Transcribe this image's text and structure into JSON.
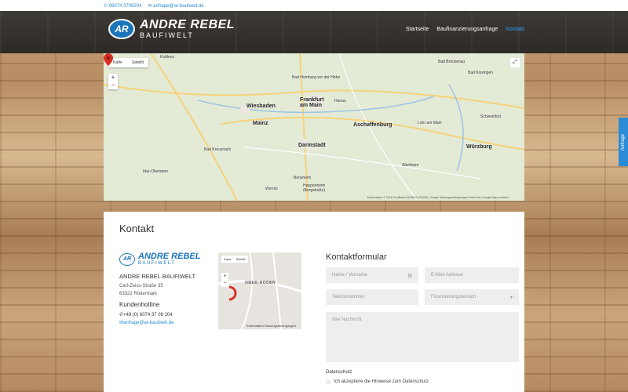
{
  "topbar": {
    "phone": "06074 3708204",
    "email": "anfrage@ar-baufwelt.de"
  },
  "brand": {
    "name": "ANDRE REBEL",
    "sub": "BAUFIWELT",
    "badge": "AR"
  },
  "nav": [
    {
      "label": "Startseite",
      "active": false
    },
    {
      "label": "Baufinanzierungsanfrage",
      "active": false
    },
    {
      "label": "Kontakt",
      "active": true
    }
  ],
  "map": {
    "tabs": [
      "Karte",
      "Satellit"
    ],
    "cities": {
      "frankfurt": "Frankfurt am Main",
      "wiesbaden": "Wiesbaden",
      "mainz": "Mainz",
      "darmstadt": "Darmstadt",
      "hanau": "Hanau",
      "aschaffenburg": "Aschaffenburg",
      "wuerzburg": "Würzburg",
      "schweinfurt": "Schweinfurt",
      "badkissingen": "Bad Kissingen",
      "koblenz": "Koblenz",
      "badkreuznach": "Bad Kreuznach",
      "worms": "Worms",
      "wertheim": "Wertheim",
      "badhomburg": "Bad Homburg vor der Höhe",
      "lohr": "Lohr am Main",
      "idar": "Idar-Oberstein",
      "bensheim": "Bensheim",
      "badbrueckenau": "Bad Brückenau",
      "heppenheim": "Heppenheim (Bergstraße)"
    },
    "footer": "Kartendaten © 2018 GeoBasis-DE/BKG (©2009), Google   Nutzungsbedingungen   Fehler bei Google Maps melden"
  },
  "contact": {
    "title": "Kontakt",
    "company": "ANDRE REBEL BAUFIWELT",
    "street": "Carl-Zeiss-Straße 35",
    "city": "63322 Rödermark",
    "hotline_title": "Kundenhotline",
    "phone": "+49 (0) 6074 37 08 204",
    "email": "anfrage@ar-baufwelt.de"
  },
  "smallmap": {
    "tabs": [
      "Karte",
      "Satellit"
    ],
    "place": "OBER-RODEN",
    "footer": "Kartendaten   Nutzungsbedingungen"
  },
  "form": {
    "title": "Kontaktformular",
    "name_ph": "Name / Vorname",
    "email_ph": "E-Mail-Adresse",
    "phone_ph": "Telefonnummer",
    "select_ph": "Finanzierungsbereich",
    "message_ph": "Ihre Nachricht",
    "privacy_label": "Datenschutz",
    "privacy_text": "Ich akzeptiere die Hinweise zum Datenschutz"
  },
  "side_tab": "Anfrage"
}
